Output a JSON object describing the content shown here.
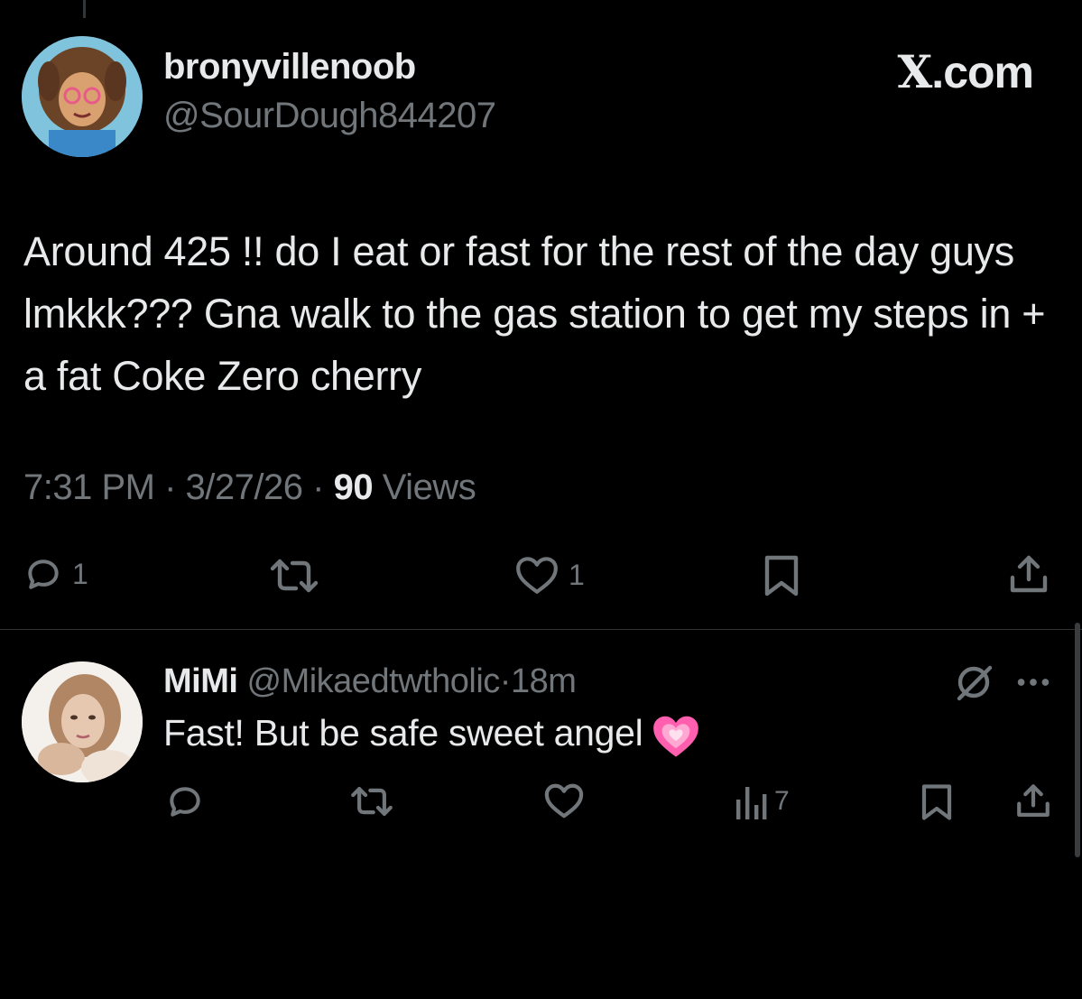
{
  "tweet": {
    "display_name": "bronyvillenoob",
    "handle": "@SourDough844207",
    "brand": {
      "x": "X",
      "rest": ".com"
    },
    "text": "Around 425 !! do I eat or fast for the rest of the day guys lmkkk??? Gna walk to the gas station to get my steps in + a fat Coke Zero cherry",
    "time": "7:31 PM",
    "date": "3/27/26",
    "sep": "·",
    "views_count": "90",
    "views_label": "Views",
    "actions": {
      "reply_count": "1",
      "like_count": "1"
    },
    "icons": [
      "reply-icon",
      "repost-icon",
      "heart-icon",
      "bookmark-icon",
      "share-icon"
    ]
  },
  "reply": {
    "display_name": "MiMi",
    "handle": "@Mikaedtwtholic",
    "sep": "·",
    "time": "18m",
    "text": "Fast! But be safe sweet angel",
    "emoji": "growing-heart-emoji",
    "views_count": "7",
    "icons": [
      "grok-icon",
      "more-icon",
      "reply-icon",
      "repost-icon",
      "heart-icon",
      "views-icon",
      "bookmark-icon",
      "share-icon"
    ]
  },
  "colors": {
    "background": "#000000",
    "primary_text": "#e7e9ea",
    "secondary_text": "#71767b",
    "divider": "#2f3336",
    "emoji_pink": "#ff5fae"
  }
}
